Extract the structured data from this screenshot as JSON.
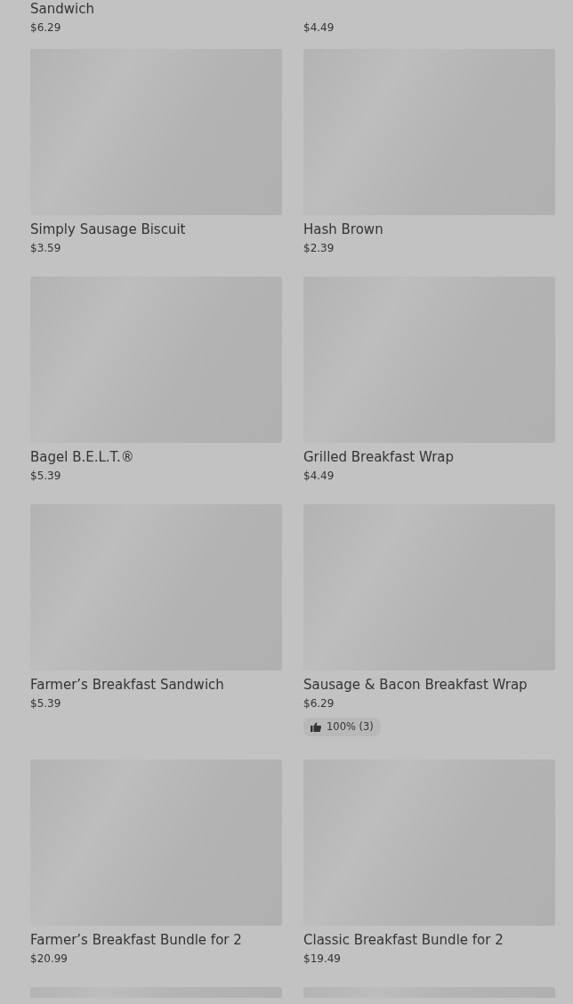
{
  "top_row": [
    {
      "name": "Sandwich",
      "price": "$6.29"
    },
    {
      "price": "$4.49"
    }
  ],
  "items": [
    {
      "name": "Simply Sausage Biscuit",
      "price": "$3.59"
    },
    {
      "name": "Hash Brown",
      "price": "$2.39"
    },
    {
      "name": "Bagel B.E.L.T.®",
      "price": "$5.39"
    },
    {
      "name": "Grilled Breakfast Wrap",
      "price": "$4.49"
    },
    {
      "name": "Farmer’s Breakfast Sandwich",
      "price": "$5.39"
    },
    {
      "name": "Sausage & Bacon Breakfast Wrap",
      "price": "$6.29",
      "rating": "100% (3)"
    },
    {
      "name": "Farmer’s Breakfast Bundle for 2",
      "price": "$20.99"
    },
    {
      "name": "Classic Breakfast Bundle for 2",
      "price": "$19.49"
    }
  ]
}
